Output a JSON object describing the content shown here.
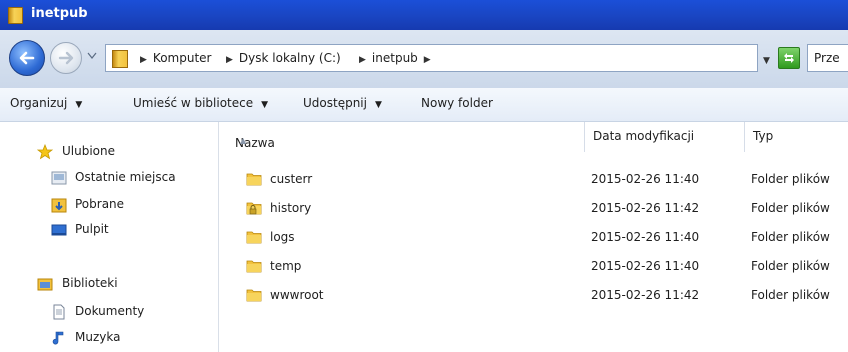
{
  "window": {
    "title": "inetpub"
  },
  "address": {
    "crumbs": [
      "Komputer",
      "Dysk lokalny (C:)",
      "inetpub"
    ],
    "search_placeholder": "Prze"
  },
  "toolbar": {
    "organize": "Organizuj",
    "include_in_library": "Umieść w bibliotece",
    "share": "Udostępnij",
    "new_folder": "Nowy folder"
  },
  "navpane": {
    "favorites": {
      "label": "Ulubione",
      "items": [
        "Ostatnie miejsca",
        "Pobrane",
        "Pulpit"
      ]
    },
    "libraries": {
      "label": "Biblioteki",
      "items": [
        "Dokumenty",
        "Muzyka"
      ]
    }
  },
  "columns": {
    "name": "Nazwa",
    "date": "Data modyfikacji",
    "type": "Typ"
  },
  "files": [
    {
      "name": "custerr",
      "date": "2015-02-26 11:40",
      "type": "Folder plików",
      "locked": false
    },
    {
      "name": "history",
      "date": "2015-02-26 11:42",
      "type": "Folder plików",
      "locked": true
    },
    {
      "name": "logs",
      "date": "2015-02-26 11:40",
      "type": "Folder plików",
      "locked": false
    },
    {
      "name": "temp",
      "date": "2015-02-26 11:40",
      "type": "Folder plików",
      "locked": false
    },
    {
      "name": "wwwroot",
      "date": "2015-02-26 11:42",
      "type": "Folder plików",
      "locked": false
    }
  ],
  "colors": {
    "titlebar": "#1a46c4",
    "folder": "#f2c23e"
  }
}
